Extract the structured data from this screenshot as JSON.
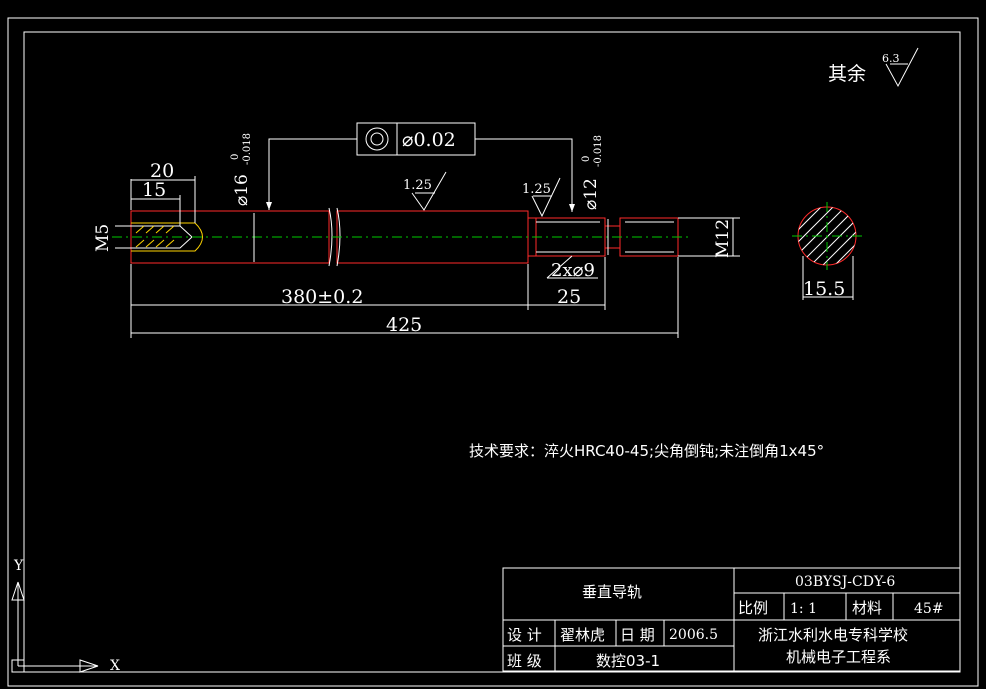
{
  "drawing": {
    "roughness": {
      "label": "其余",
      "value": "6.3"
    },
    "tolerance_frame": {
      "value": "⌀0.02"
    },
    "dims": {
      "d20": "20",
      "d15": "15",
      "m5": "M5",
      "phi16": "⌀16",
      "phi16_up": "0",
      "phi16_lo": "-0.018",
      "phi12": "⌀12",
      "phi12_up": "0",
      "phi12_lo": "-0.018",
      "r125a": "1.25",
      "r125b": "1.25",
      "m12": "M12",
      "groove": "2x⌀9",
      "d380": "380±0.2",
      "d25": "25",
      "d425": "425",
      "d155": "15.5"
    },
    "tech_req": "技术要求：淬火HRC40-45;尖角倒钝;未注倒角1x45°"
  },
  "title_block": {
    "part_name": "垂直导轨",
    "drawing_no": "03BYSJ-CDY-6",
    "scale_label": "比例",
    "scale_value": "1: 1",
    "material_label": "材料",
    "material_value": "45#",
    "design_label": "设 计",
    "designer": "翟林虎",
    "date_label": "日 期",
    "date_value": "2006.5",
    "class_label": "班 级",
    "class_value": "数控03-1",
    "school_line1": "浙江水利水电专科学校",
    "school_line2": "机械电子工程系"
  },
  "ucs": {
    "x": "X",
    "y": "Y"
  }
}
